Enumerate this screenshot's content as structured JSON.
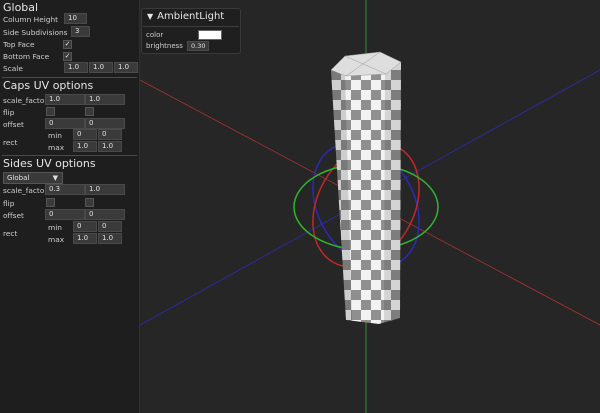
{
  "colors": {
    "background": "#262626",
    "panel": "#1e1e1e",
    "field": "#3a3a3a",
    "axis_red": "#b03030",
    "axis_green": "#3aa83a",
    "axis_blue": "#2a2ab8",
    "swatch": "#ffffff"
  },
  "global": {
    "title": "Global",
    "column_height": {
      "label": "Column Height",
      "value": "10"
    },
    "side_subdivisions": {
      "label": "Side Subdivisions",
      "value": "3"
    },
    "top_face": {
      "label": "Top Face",
      "checked": "✓"
    },
    "bottom_face": {
      "label": "Bottom Face",
      "checked": "✓"
    },
    "scale": {
      "label": "Scale",
      "values": [
        "1.0",
        "1.0",
        "1.0"
      ]
    }
  },
  "caps_uv": {
    "title": "Caps UV options",
    "scale_factor": {
      "label": "scale_factor",
      "values": [
        "1.0",
        "1.0"
      ]
    },
    "flip": {
      "label": "flip"
    },
    "offset": {
      "label": "offset",
      "values": [
        "0",
        "0"
      ]
    },
    "rect": {
      "label": "rect",
      "min_label": "min",
      "min": [
        "0",
        "0"
      ],
      "max_label": "max",
      "max": [
        "1.0",
        "1.0"
      ]
    }
  },
  "sides_uv": {
    "title": "Sides UV options",
    "mode": {
      "selected": "Global",
      "icon": "caret-down-icon"
    },
    "scale_factor": {
      "label": "scale_factor",
      "values": [
        "0.3",
        "1.0"
      ]
    },
    "flip": {
      "label": "flip"
    },
    "offset": {
      "label": "offset",
      "values": [
        "0",
        "0"
      ]
    },
    "rect": {
      "label": "rect",
      "min_label": "min",
      "min": [
        "0",
        "0"
      ],
      "max_label": "max",
      "max": [
        "1.0",
        "1.0"
      ]
    }
  },
  "ambient_light": {
    "title": "AmbientLight",
    "collapse_icon": "▼",
    "color_label": "color",
    "brightness_label": "brightness",
    "brightness": "0.30"
  }
}
